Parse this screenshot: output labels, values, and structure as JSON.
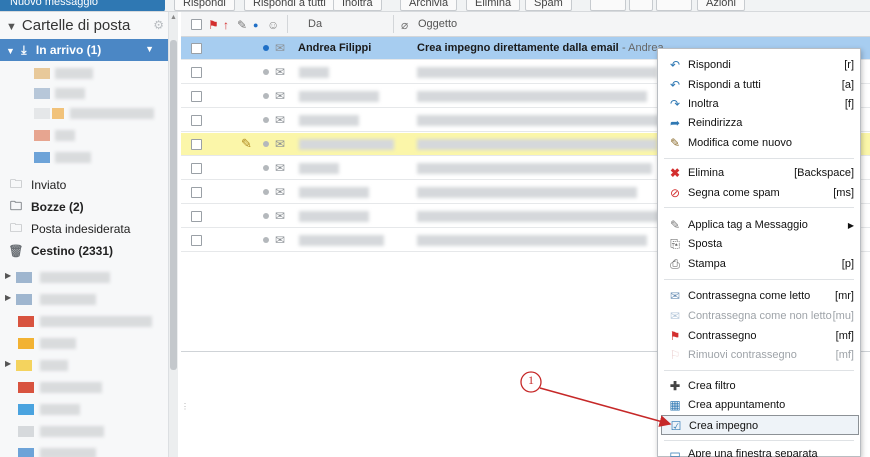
{
  "toolbar": {
    "new_message": "Nuovo messaggio",
    "reply": "Rispondi",
    "reply_all": "Rispondi a tutti",
    "forward": "Inoltra",
    "archive": "Archivia",
    "delete": "Elimina",
    "spam": "Spam",
    "actions": "Azioni"
  },
  "sidebar": {
    "header": "Cartelle di posta",
    "inbox": "In arrivo (1)",
    "folders": [
      {
        "label": "Inviato",
        "icon": "sent-folder-icon"
      },
      {
        "label": "Bozze (2)",
        "icon": "drafts-folder-icon"
      },
      {
        "label": "Posta indesiderata",
        "icon": "spam-folder-icon"
      },
      {
        "label": "Cestino (2331)",
        "icon": "trash-icon"
      }
    ]
  },
  "list": {
    "col_from": "Da",
    "col_subject": "Oggetto",
    "selected_row": {
      "sender": "Andrea Filippi",
      "subject": "Crea impegno direttamente dalla email",
      "snippet": "- Andrea"
    }
  },
  "context_menu": {
    "items": [
      {
        "label": "Rispondi",
        "key": "[r]",
        "icon": "reply-icon"
      },
      {
        "label": "Rispondi a tutti",
        "key": "[a]",
        "icon": "reply-all-icon"
      },
      {
        "label": "Inoltra",
        "key": "[f]",
        "icon": "forward-icon"
      },
      {
        "label": "Reindirizza",
        "key": "",
        "icon": "redirect-icon"
      },
      {
        "label": "Modifica come nuovo",
        "key": "",
        "icon": "pencil-icon"
      },
      {
        "label": "Elimina",
        "key": "[Backspace]",
        "icon": "delete-x-icon"
      },
      {
        "label": "Segna come spam",
        "key": "[ms]",
        "icon": "spam-icon"
      },
      {
        "label": "Applica tag a Messaggio",
        "key": "",
        "icon": "tag-icon"
      },
      {
        "label": "Sposta",
        "key": "",
        "icon": "move-icon"
      },
      {
        "label": "Stampa",
        "key": "[p]",
        "icon": "print-icon"
      },
      {
        "label": "Contrassegna come letto",
        "key": "[mr]",
        "icon": "mark-read-icon"
      },
      {
        "label": "Contrassegna come non letto",
        "key": "[mu]",
        "icon": "mark-unread-icon"
      },
      {
        "label": "Contrassegno",
        "key": "[mf]",
        "icon": "flag-icon"
      },
      {
        "label": "Rimuovi contrassegno",
        "key": "[mf]",
        "icon": "unflag-icon"
      },
      {
        "label": "Crea filtro",
        "key": "",
        "icon": "filter-icon"
      },
      {
        "label": "Crea appuntamento",
        "key": "",
        "icon": "calendar-icon"
      },
      {
        "label": "Crea impegno",
        "key": "",
        "icon": "task-icon"
      },
      {
        "label": "Apre una finestra separata",
        "key": "",
        "icon": "window-icon"
      }
    ]
  },
  "annotation": {
    "label": "1",
    "color": "#c62828"
  },
  "colors": {
    "accent": "#2f78b3",
    "selected_row": "#a7cdf0",
    "flagged_row": "#fbf6a9",
    "inbox_highlight": "#4b87c5"
  }
}
